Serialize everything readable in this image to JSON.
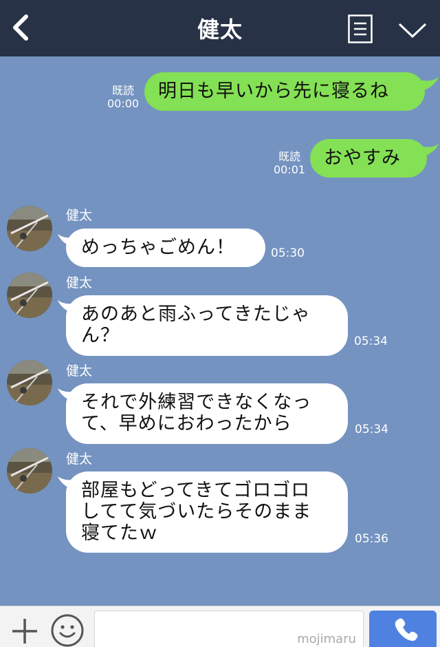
{
  "header": {
    "title": "健太",
    "back_icon": "chevron-left-icon",
    "menu_icon": "menu-lines-icon",
    "dropdown_icon": "chevron-down-icon"
  },
  "messages": [
    {
      "type": "out",
      "text": "明日も早いから先に寝るね",
      "read": "既読",
      "time": "00:00"
    },
    {
      "type": "out",
      "text": "おやすみ",
      "read": "既読",
      "time": "00:01"
    },
    {
      "type": "in",
      "sender": "健太",
      "text": "めっちゃごめん！",
      "time": "05:30"
    },
    {
      "type": "in",
      "sender": "健太",
      "text": "あのあと雨ふってきたじゃ\nん？",
      "time": "05:34"
    },
    {
      "type": "in",
      "sender": "健太",
      "text": "それで外練習できなくなっ\nて、早めにおわったから",
      "time": "05:34"
    },
    {
      "type": "in",
      "sender": "健太",
      "text": "部屋もどってきてゴロゴロ\nしてて気づいたらそのまま\n寝てたｗ",
      "time": "05:36"
    }
  ],
  "input_bar": {
    "watermark": "mojimaru",
    "plus_icon": "plus-icon",
    "emoji_icon": "smiley-icon",
    "call_icon": "phone-icon"
  },
  "colors": {
    "header_bg": "#273246",
    "chat_bg": "#7493c0",
    "outgoing_bubble": "#84e054",
    "incoming_bubble": "#ffffff",
    "call_button": "#4f82e0"
  }
}
